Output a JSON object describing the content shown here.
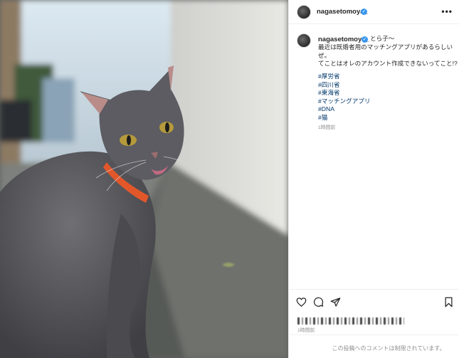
{
  "post": {
    "username": "nagasetomoya_",
    "verified_icon": "verified-badge-icon",
    "more_icon": "more-options-icon",
    "more_label": "•••"
  },
  "caption": {
    "username": "nagasetomoya_",
    "line1_suffix": "とら子〜",
    "line2": "最近は既婚者用のマッチングアプリがあるらしい",
    "line3": "ぜ。",
    "line4": "てことはオレのアカウント作成できないってこと!?",
    "hashtags": [
      "#厚労省",
      "#四川省",
      "#東海省",
      "#マッチングアプリ",
      "#DNA",
      "#猫"
    ],
    "time": "1時間前"
  },
  "actions": {
    "like_icon": "heart-icon",
    "comment_icon": "comment-icon",
    "share_icon": "share-icon",
    "save_icon": "bookmark-icon"
  },
  "footer": {
    "time": "1時間前",
    "comments_disabled": "この投稿へのコメントは制限されています。"
  },
  "colors": {
    "link": "#00376b",
    "verified": "#3897f0",
    "muted": "#8e8e8e",
    "collar": "#e2572a"
  }
}
